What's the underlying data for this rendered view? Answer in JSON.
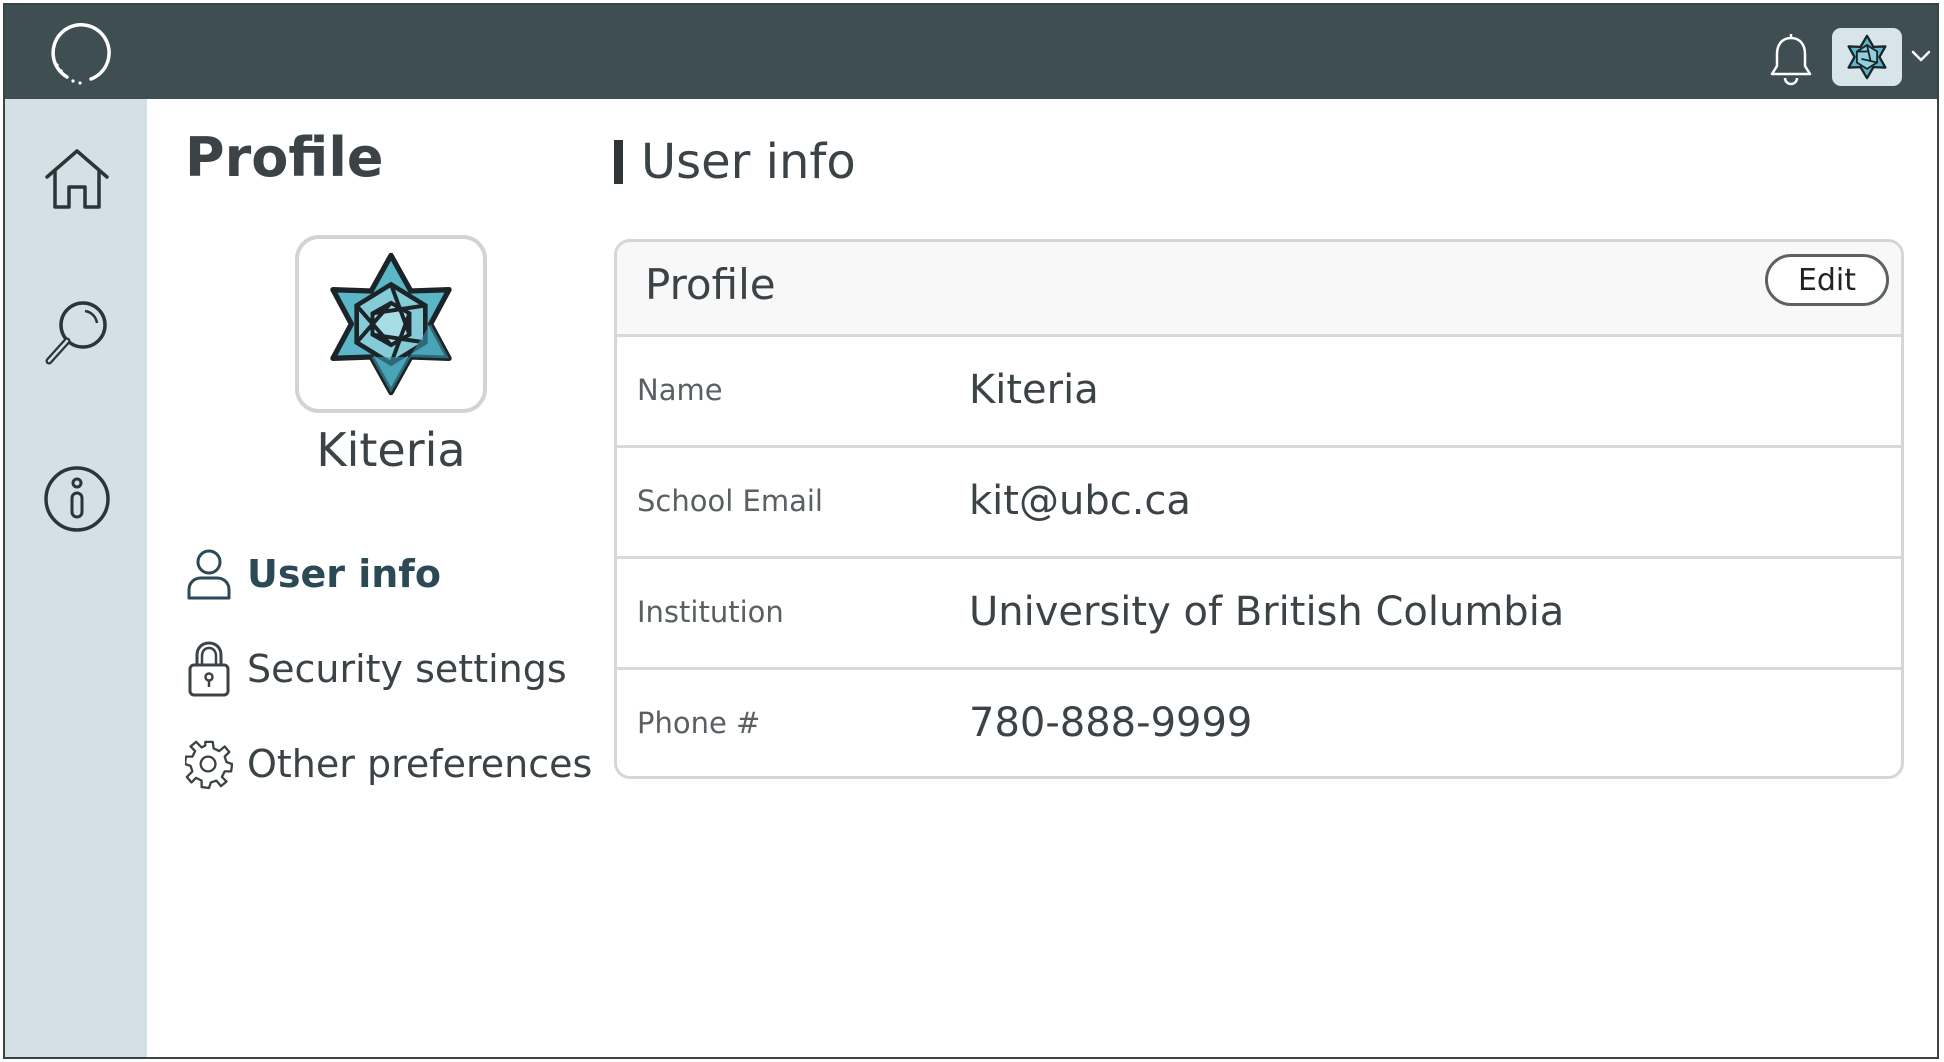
{
  "header": {
    "logo_icon": "circle-loader-icon",
    "notifications_icon": "bell-icon",
    "avatar_icon": "star-logo-icon",
    "dropdown_icon": "chevron-down-icon"
  },
  "sidebar": {
    "items": [
      {
        "icon": "home-icon"
      },
      {
        "icon": "search-icon"
      },
      {
        "icon": "info-icon"
      }
    ]
  },
  "profile": {
    "heading": "Profile",
    "name": "Kiteria",
    "menu": [
      {
        "label": "User info",
        "icon": "user-icon",
        "active": true
      },
      {
        "label": "Security settings",
        "icon": "lock-icon",
        "active": false
      },
      {
        "label": "Other preferences",
        "icon": "gear-icon",
        "active": false
      }
    ]
  },
  "user_info": {
    "section_title": "User info",
    "card_title": "Profile",
    "edit_label": "Edit",
    "rows": [
      {
        "label": "Name",
        "value": "Kiteria"
      },
      {
        "label": "School Email",
        "value": "kit@ubc.ca"
      },
      {
        "label": "Institution",
        "value": "University of British Columbia"
      },
      {
        "label": "Phone #",
        "value": "780-888-9999"
      }
    ]
  },
  "colors": {
    "topbar": "#3f4e53",
    "sidebar": "#d3e0e5",
    "accent": "#2b4a55",
    "star_fill": "#5bb6c8"
  }
}
